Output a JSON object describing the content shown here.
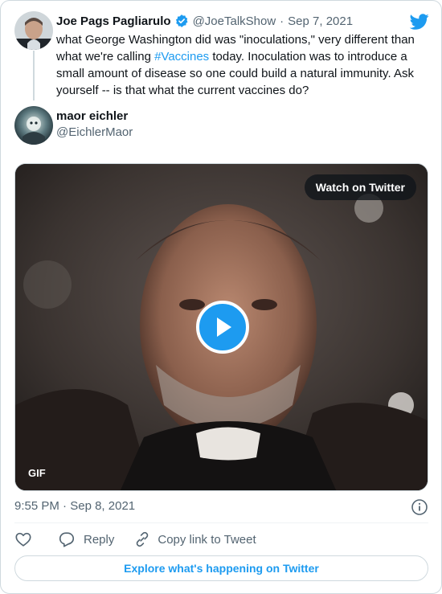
{
  "original_tweet": {
    "author_name": "Joe Pags Pagliarulo",
    "handle": "@JoeTalkShow",
    "separator": "·",
    "date": "Sep 7, 2021",
    "text_before": "what George Washington did was \"inoculations,\" very different than what we're calling ",
    "hashtag": "#Vaccines",
    "text_after": " today.  Inoculation was to introduce a small amount of disease so one could build a natural immunity. Ask yourself -- is that what the current vaccines do?"
  },
  "reply": {
    "author_name": "maor eichler",
    "handle": "@EichlerMaor"
  },
  "media": {
    "watch_label": "Watch on Twitter",
    "gif_label": "GIF"
  },
  "meta": {
    "time": "9:55 PM",
    "separator": "·",
    "date": "Sep 8, 2021"
  },
  "actions": {
    "reply_label": "Reply",
    "copy_label": "Copy link to Tweet"
  },
  "explore_label": "Explore what's happening on Twitter",
  "colors": {
    "accent": "#1d9bf0",
    "text": "#0f1419",
    "secondary": "#536471",
    "border": "#cfd9de"
  },
  "icons": [
    "twitter-bird-icon",
    "verified-badge-icon",
    "play-icon",
    "info-icon",
    "heart-icon",
    "reply-icon",
    "link-icon"
  ]
}
